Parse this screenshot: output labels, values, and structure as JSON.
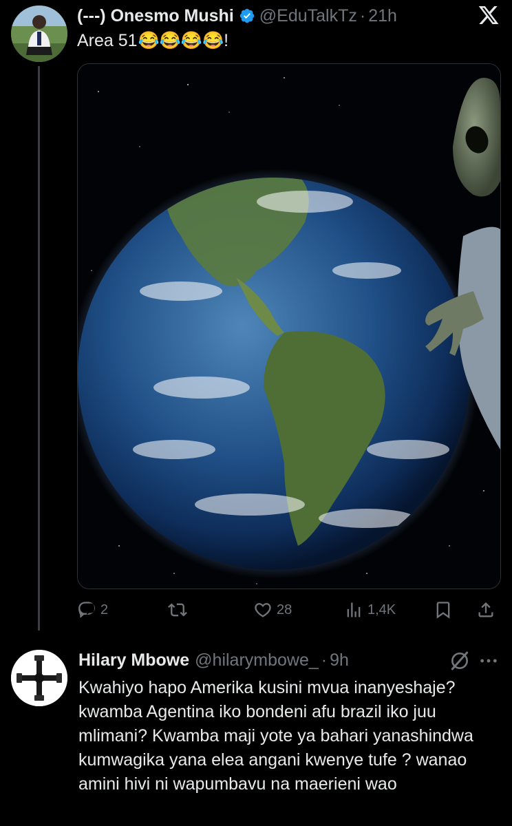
{
  "tweet1": {
    "name": "(---) Onesmo Mushi",
    "handle": "@EduTalkTz",
    "separator": "·",
    "time": "21h",
    "text": "Area 51",
    "emojis": "😂😂😂😂",
    "text_end": "!",
    "media": {
      "icon": "earth-and-alien-image"
    },
    "actions": {
      "replies": "2",
      "reposts": "",
      "likes": "28",
      "views": "1,4K"
    }
  },
  "tweet2": {
    "name": "Hilary Mbowe",
    "handle": "@hilarymbowe_",
    "separator": "·",
    "time": "9h",
    "text": "Kwahiyo hapo Amerika kusini mvua inanyeshaje? kwamba Agentina iko bondeni afu brazil iko juu mlimani? Kwamba maji yote ya bahari yanashindwa kumwagika yana elea angani kwenye tufe ? wanao amini hivi ni wapumbavu na maerieni wao"
  },
  "colors": {
    "background": "#000000",
    "text": "#e7e9ea",
    "muted": "#71767b",
    "verified": "#1d9bf0"
  }
}
